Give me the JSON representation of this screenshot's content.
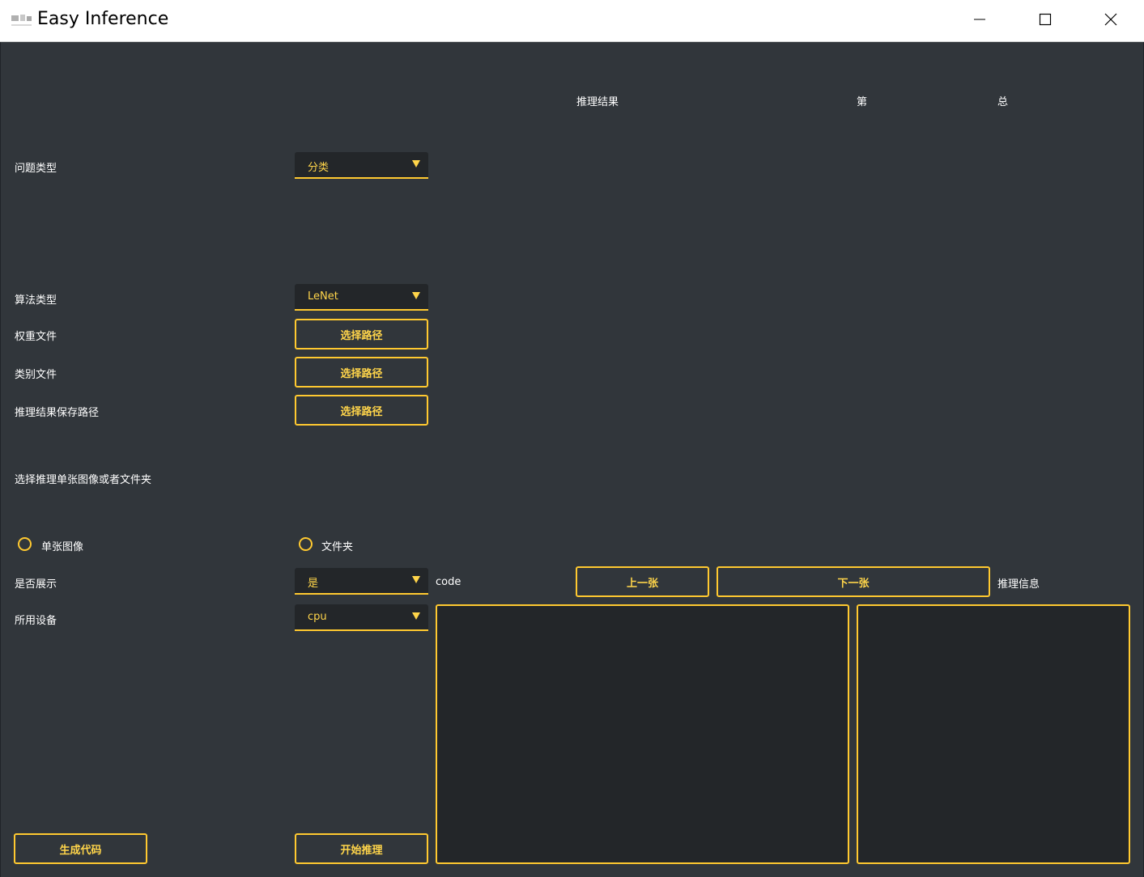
{
  "window": {
    "title": "Easy Inference",
    "minimize_icon": "minimize-icon",
    "maximize_icon": "maximize-icon",
    "close_icon": "close-icon"
  },
  "colors": {
    "accent": "#ffc930",
    "accent_text": "#ffd54a",
    "background": "#31363b",
    "field_background": "#232629",
    "text": "#ffffff"
  },
  "header": {
    "result_label": "推理结果",
    "index_label": "第",
    "total_label": "总"
  },
  "form": {
    "problem_type_label": "问题类型",
    "problem_type_value": "分类",
    "algorithm_type_label": "算法类型",
    "algorithm_type_value": "LeNet",
    "weight_file_label": "权重文件",
    "weight_file_button": "选择路径",
    "class_file_label": "类别文件",
    "class_file_button": "选择路径",
    "save_path_label": "推理结果保存路径",
    "save_path_button": "选择路径",
    "source_prompt": "选择推理单张图像或者文件夹",
    "radio_single_label": "单张图像",
    "radio_folder_label": "文件夹",
    "show_label": "是否展示",
    "show_value": "是",
    "device_label": "所用设备",
    "device_value": "cpu"
  },
  "actions": {
    "generate_code": "生成代码",
    "start_inference": "开始推理"
  },
  "output": {
    "code_label": "code",
    "prev_button": "上一张",
    "next_button": "下一张",
    "info_label": "推理信息"
  }
}
